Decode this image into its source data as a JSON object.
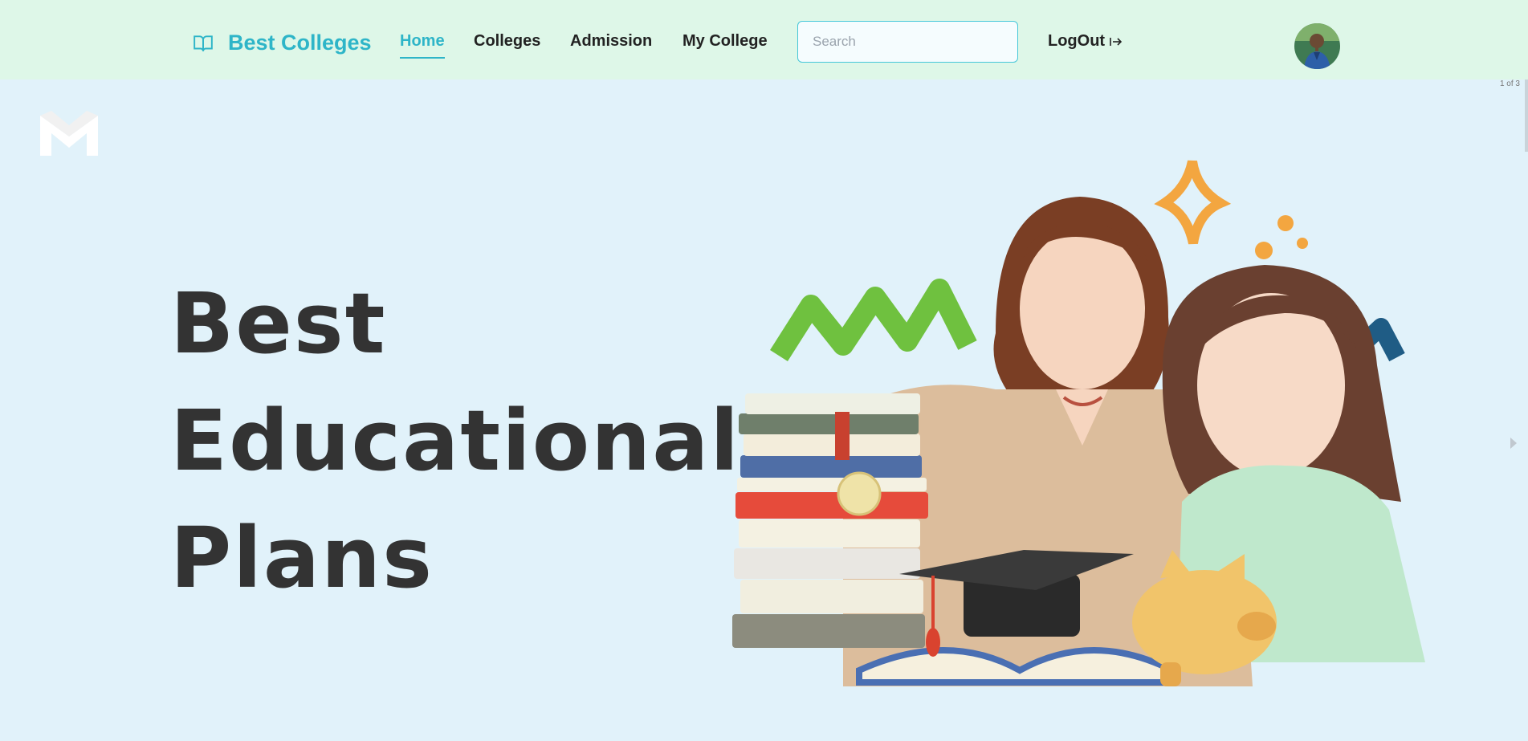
{
  "nav": {
    "brand": "Best Colleges",
    "links": [
      "Home",
      "Colleges",
      "Admission",
      "My College"
    ],
    "active": "Home",
    "search_placeholder": "Search",
    "logout_label": "LogOut",
    "logout_icon": "logout-arrow-icon"
  },
  "carousel": {
    "counter": "1 of 3",
    "title_lines": [
      "Best",
      "Educational",
      "Plans"
    ]
  },
  "colors": {
    "nav_bg": "#def7e8",
    "page_bg": "#e1f2fa",
    "accent": "#2eb5c8",
    "heading": "#333333"
  }
}
